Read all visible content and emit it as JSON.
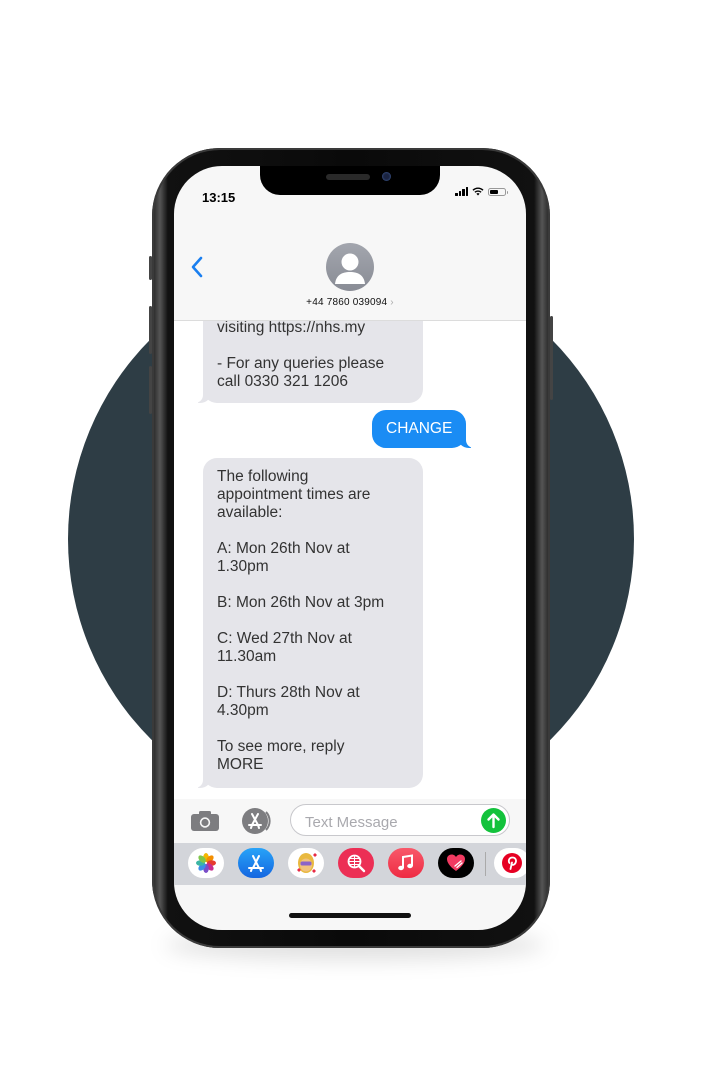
{
  "status_bar": {
    "time": "13:15",
    "icons": [
      "cellular-signal-icon",
      "wifi-icon",
      "battery-icon"
    ]
  },
  "header": {
    "back_icon": "chevron-left-icon",
    "avatar_icon": "person-silhouette-icon",
    "contact_number": "+44 7860 039094",
    "contact_chevron": "›"
  },
  "messages": [
    {
      "direction": "incoming",
      "text": "visiting https://nhs.my\n\n- For any queries please\ncall 0330 321 1206"
    },
    {
      "direction": "outgoing",
      "text": "CHANGE"
    },
    {
      "direction": "incoming",
      "text": "The following\nappointment times are\navailable:\n\nA: Mon 26th Nov at\n1.30pm\n\nB: Mon 26th Nov at 3pm\n\nC: Wed 27th Nov at\n11.30am\n\nD: Thurs 28th Nov at\n4.30pm\n\nTo see more, reply\nMORE"
    }
  ],
  "input_bar": {
    "camera_icon": "camera-icon",
    "apps_icon": "app-store-icon",
    "placeholder": "Text Message",
    "value": "",
    "send_icon": "arrow-up-icon"
  },
  "app_tray": [
    {
      "name": "photos-app-icon",
      "bg": "#ffffff"
    },
    {
      "name": "app-store-app-icon",
      "bg": "#1a8cf4"
    },
    {
      "name": "memoji-app-icon",
      "bg": "#ffffff"
    },
    {
      "name": "image-search-app-icon",
      "bg": "#ec2f55"
    },
    {
      "name": "music-app-icon",
      "bg": "#f33a4f"
    },
    {
      "name": "digital-touch-app-icon",
      "bg": "#000000"
    },
    {
      "name": "pinterest-app-icon",
      "bg": "#ffffff"
    }
  ],
  "colors": {
    "background_circle": "#2e3d45",
    "outgoing_bubble": "#1a8cf4",
    "incoming_bubble": "#e5e5ea",
    "accent_blue": "#1a7ff0",
    "send_green": "#13c23c"
  }
}
